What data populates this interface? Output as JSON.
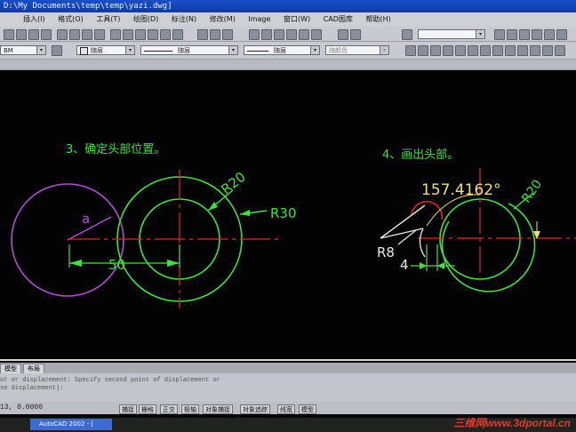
{
  "window": {
    "title": "D:\\My Documents\\temp\\temp\\yazi.dwg]"
  },
  "menu": [
    "插入(I)",
    "格式(O)",
    "工具(T)",
    "绘图(D)",
    "标注(N)",
    "修改(M)",
    "Image",
    "窗口(W)",
    "CAD图库",
    "帮助(H)"
  ],
  "toolbar": {
    "layer_combo": "随层",
    "linetype_combo": "随层",
    "lineweight_combo": "随层",
    "plotstyle_combo": "随颜色",
    "left_combo": "BM"
  },
  "drawing": {
    "step3_title": "3、确定头部位置。",
    "step4_title": "4、画出头部。",
    "left_group": {
      "label_a": "a",
      "label_r20": "R20",
      "label_r30": "R30",
      "label_50": "50"
    },
    "right_group": {
      "label_angle": "157.4162°",
      "label_r20": "R20",
      "label_r8": "R8",
      "label_4": "4"
    }
  },
  "tabs": [
    "模型",
    "布局"
  ],
  "command": {
    "line1": "ot or displacement: Specify second point of displacement or",
    "line2": "se displacement):"
  },
  "status": {
    "coords": "13, 0.0000",
    "buttons": [
      "捕捉",
      "栅格",
      "正交",
      "极轴",
      "对象捕捉",
      "对象追踪",
      "线宽",
      "模型"
    ]
  },
  "taskbar": {
    "app": "AutoCAD 2002 - ["
  },
  "watermark": "三维网www.3dportal.cn",
  "colors": {
    "green": "#3ee23e",
    "red": "#e2262a",
    "magenta": "#b24bd8",
    "white": "#eaeaea",
    "yellow": "#ece070",
    "canvas": "#030303"
  }
}
